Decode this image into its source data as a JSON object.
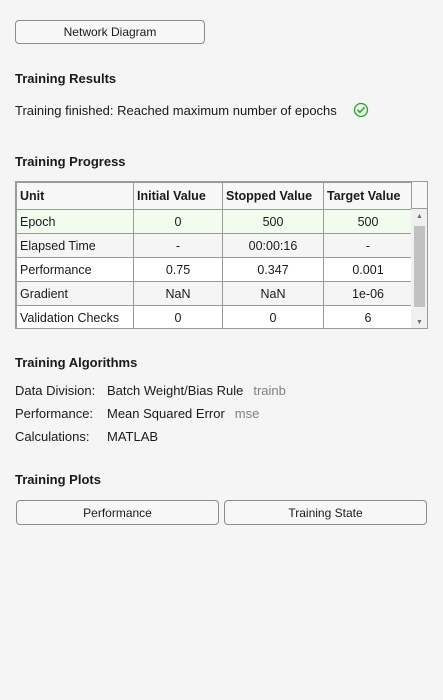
{
  "buttons": {
    "network_diagram": "Network Diagram",
    "performance_plot": "Performance",
    "training_state_plot": "Training State"
  },
  "results": {
    "title": "Training Results",
    "status": "Training finished: Reached maximum number of epochs",
    "status_icon": "success-check-icon",
    "status_color": "#2ca02c"
  },
  "progress": {
    "title": "Training Progress",
    "columns": [
      "Unit",
      "Initial Value",
      "Stopped Value",
      "Target Value"
    ],
    "rows": [
      [
        "Epoch",
        "0",
        "500",
        "500"
      ],
      [
        "Elapsed Time",
        "-",
        "00:00:16",
        "-"
      ],
      [
        "Performance",
        "0.75",
        "0.347",
        "0.001"
      ],
      [
        "Gradient",
        "NaN",
        "NaN",
        "1e-06"
      ],
      [
        "Validation Checks",
        "0",
        "0",
        "6"
      ]
    ]
  },
  "algorithms": {
    "title": "Training Algorithms",
    "items": [
      {
        "label": "Data Division:",
        "value": "Batch Weight/Bias Rule",
        "sub": "trainb"
      },
      {
        "label": "Performance:",
        "value": "Mean Squared Error",
        "sub": "mse"
      },
      {
        "label": "Calculations:",
        "value": "MATLAB",
        "sub": ""
      }
    ]
  },
  "plots": {
    "title": "Training Plots"
  }
}
